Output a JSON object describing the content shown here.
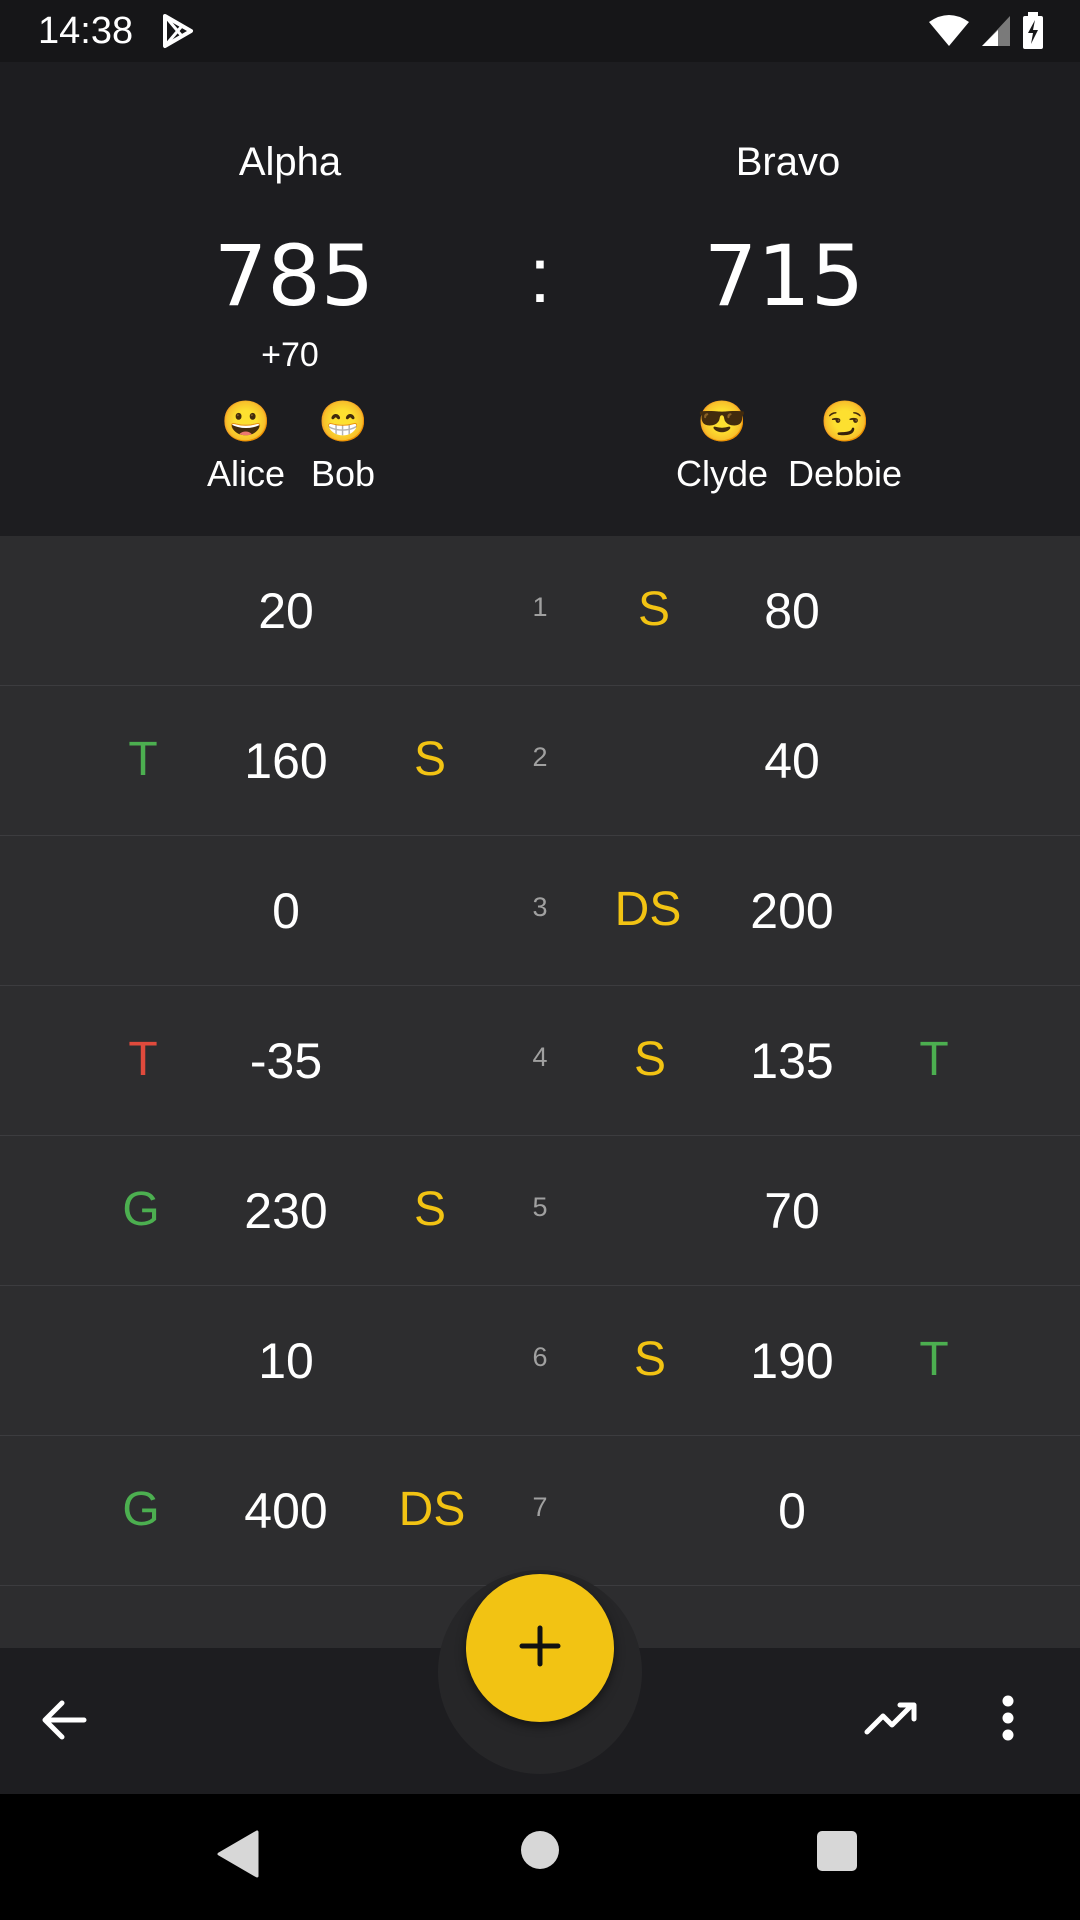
{
  "status": {
    "time": "14:38"
  },
  "header": {
    "team_left": "Alpha",
    "team_right": "Bravo",
    "score_left": "785",
    "score_right": "715",
    "separator": ":",
    "difference": "+70",
    "players_left": [
      {
        "emoji": "😀",
        "name": "Alice"
      },
      {
        "emoji": "😁",
        "name": "Bob"
      }
    ],
    "players_right": [
      {
        "emoji": "😎",
        "name": "Clyde"
      },
      {
        "emoji": "😏",
        "name": "Debbie"
      }
    ]
  },
  "rounds": [
    {
      "number": "1",
      "left_value": "20",
      "left_pre": "",
      "left_post": "",
      "right_pre": "S",
      "right_value": "80",
      "right_post": ""
    },
    {
      "number": "2",
      "left_value": "160",
      "left_pre": "T",
      "left_post": "S",
      "right_pre": "",
      "right_value": "40",
      "right_post": ""
    },
    {
      "number": "3",
      "left_value": "0",
      "left_pre": "",
      "left_post": "",
      "right_pre": "DS",
      "right_value": "200",
      "right_post": ""
    },
    {
      "number": "4",
      "left_value": "-35",
      "left_pre": "T",
      "left_post": "",
      "right_pre": "S",
      "right_value": "135",
      "right_post": "T"
    },
    {
      "number": "5",
      "left_value": "230",
      "left_pre": "G",
      "left_post": "S",
      "right_pre": "",
      "right_value": "70",
      "right_post": ""
    },
    {
      "number": "6",
      "left_value": "10",
      "left_pre": "",
      "left_post": "",
      "right_pre": "S",
      "right_value": "190",
      "right_post": "T"
    },
    {
      "number": "7",
      "left_value": "400",
      "left_pre": "G",
      "left_post": "DS",
      "right_pre": "",
      "right_value": "0",
      "right_post": ""
    }
  ],
  "colors": {
    "accent": "#f2c313",
    "green": "#4caf50",
    "red": "#e04a3c"
  },
  "icons": {
    "back": "arrow-left-icon",
    "fab": "plus-icon",
    "stats": "trending-up-icon",
    "menu": "more-vert-icon"
  }
}
